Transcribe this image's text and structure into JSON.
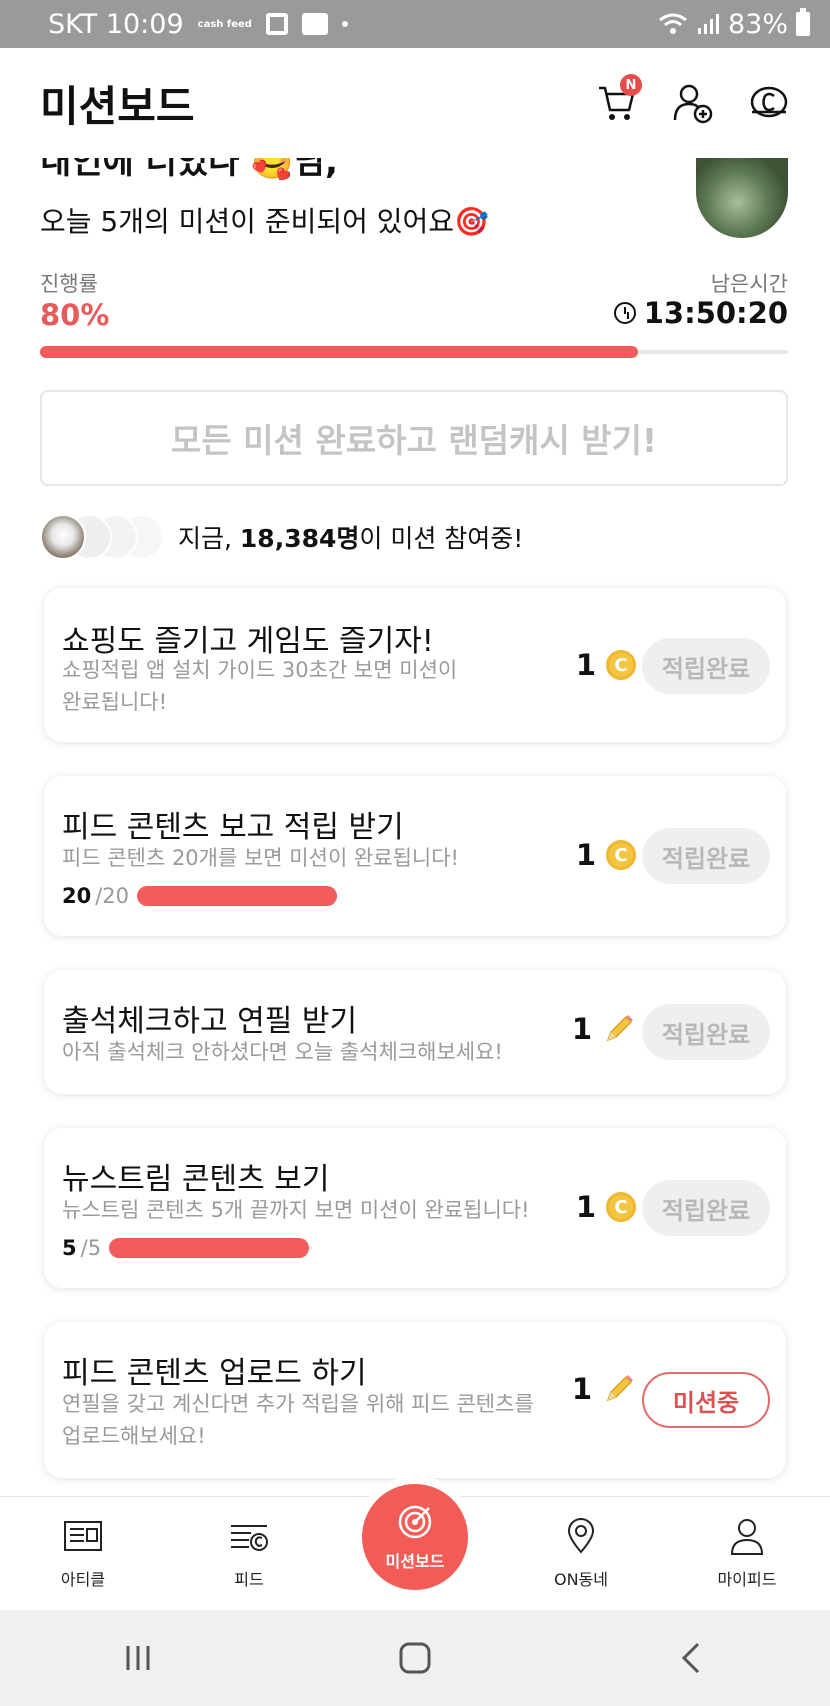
{
  "statusbar": {
    "carrier_time": "SKT 10:09",
    "cashfeed_badge": "cash feed",
    "battery": "83%"
  },
  "header": {
    "title": "미션보드",
    "cart_badge": "N",
    "icons": [
      "cart-icon",
      "add-friend-icon",
      "cash-icon"
    ]
  },
  "greeting": {
    "line1": "내인에 너있나 🥰님,",
    "line2": "오늘 5개의 미션이 준비되어 있어요🎯"
  },
  "progress": {
    "label": "진행률",
    "value_text": "80%",
    "value": 0.8,
    "time_label": "남은시간",
    "time_value": "13:50:20"
  },
  "all_complete_button": "모든 미션 완료하고 랜덤캐시 받기!",
  "participants": {
    "prefix": "지금, ",
    "count": "18,384명",
    "suffix": "이 미션 참여중!"
  },
  "missions": [
    {
      "title": "쇼핑도 즐기고 게임도 즐기자!",
      "desc": "쇼핑적립 앱 설치 가이드 30초간 보면 미션이 완료됩니다!",
      "reward": "1",
      "reward_icon": "coin-icon",
      "status": "적립완료"
    },
    {
      "title": "피드 콘텐츠 보고 적립 받기",
      "desc": "피드 콘텐츠 20개를 보면 미션이 완료됩니다!",
      "progress_done": "20",
      "progress_total": "/20",
      "progress": 1.0,
      "reward": "1",
      "reward_icon": "coin-icon",
      "status": "적립완료"
    },
    {
      "title": "출석체크하고 연필 받기",
      "desc": "아직 출석체크 안하셨다면 오늘 출석체크해보세요!",
      "reward": "1",
      "reward_icon": "pencil-icon",
      "status": "적립완료"
    },
    {
      "title": "뉴스트림 콘텐츠 보기",
      "desc": "뉴스트림 콘텐츠 5개 끝까지 보면 미션이 완료됩니다!",
      "progress_done": "5",
      "progress_total": "/5",
      "progress": 1.0,
      "reward": "1",
      "reward_icon": "coin-icon",
      "status": "적립완료"
    },
    {
      "title": "피드 콘텐츠 업로드 하기",
      "desc": "연필을 갖고 계신다면 추가 적립을 위해 피드 콘텐츠를 업로드해보세요!",
      "reward": "1",
      "reward_icon": "pencil-icon",
      "status": "미션중"
    }
  ],
  "coin_glyph": "C",
  "bottom_nav": {
    "article": "아티클",
    "feed": "피드",
    "missionboard": "미션보드",
    "on_dongne": "ON동네",
    "mypage": "마이피드"
  },
  "colors": {
    "accent": "#f25c5c",
    "progress_text": "#e75b5b",
    "coin": "#f5c542",
    "disabled_button": "#efefef"
  }
}
